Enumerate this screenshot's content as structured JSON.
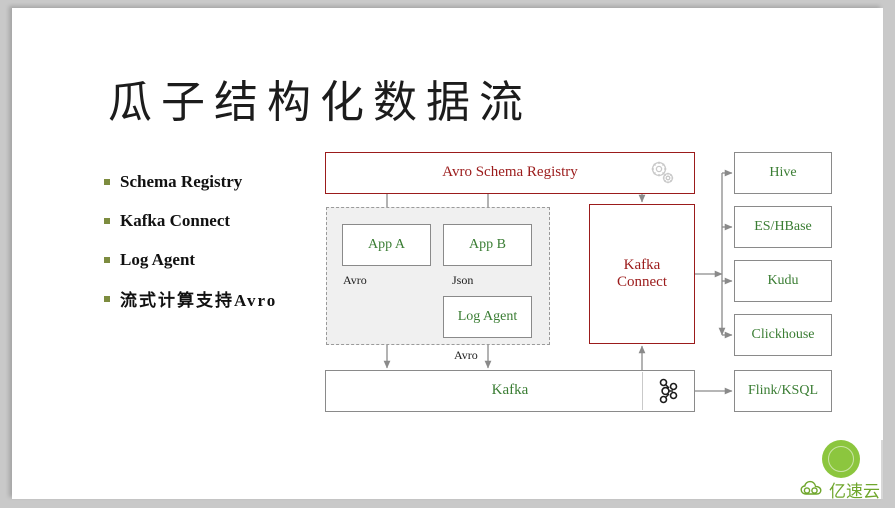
{
  "slide": {
    "title": "瓜子结构化数据流",
    "bullets": [
      {
        "label": "Schema Registry",
        "cjk": false
      },
      {
        "label": "Kafka Connect",
        "cjk": false
      },
      {
        "label": "Log Agent",
        "cjk": false
      },
      {
        "label": "流式计算支持Avro",
        "cjk": true
      }
    ]
  },
  "diagram": {
    "registry": {
      "label": "Avro Schema Registry",
      "icon": "gears-icon"
    },
    "apps": [
      {
        "label": "App A"
      },
      {
        "label": "App B"
      }
    ],
    "log_agent": {
      "label": "Log Agent"
    },
    "kafka": {
      "label": "Kafka",
      "icon": "kafka-logo-icon"
    },
    "kafka_connect": {
      "label": "Kafka\nConnect",
      "line1": "Kafka",
      "line2": "Connect"
    },
    "sinks": [
      {
        "label": "Hive"
      },
      {
        "label": "ES/HBase"
      },
      {
        "label": "Kudu"
      },
      {
        "label": "Clickhouse"
      },
      {
        "label": "Flink/KSQL"
      }
    ],
    "edge_labels": {
      "app_a_out": "Avro",
      "app_b_out": "Json",
      "log_agent_out": "Avro"
    }
  },
  "watermark": {
    "text": "亿速云",
    "icon": "cloud-icon"
  },
  "colors": {
    "accent_red": "#9b1b1b",
    "accent_green": "#3a7d33",
    "bullet_green": "#7d8c3f",
    "wire_gray": "#8a8a8a",
    "watermark_green": "#8cc63e",
    "group_fill": "#f0f0f0"
  }
}
